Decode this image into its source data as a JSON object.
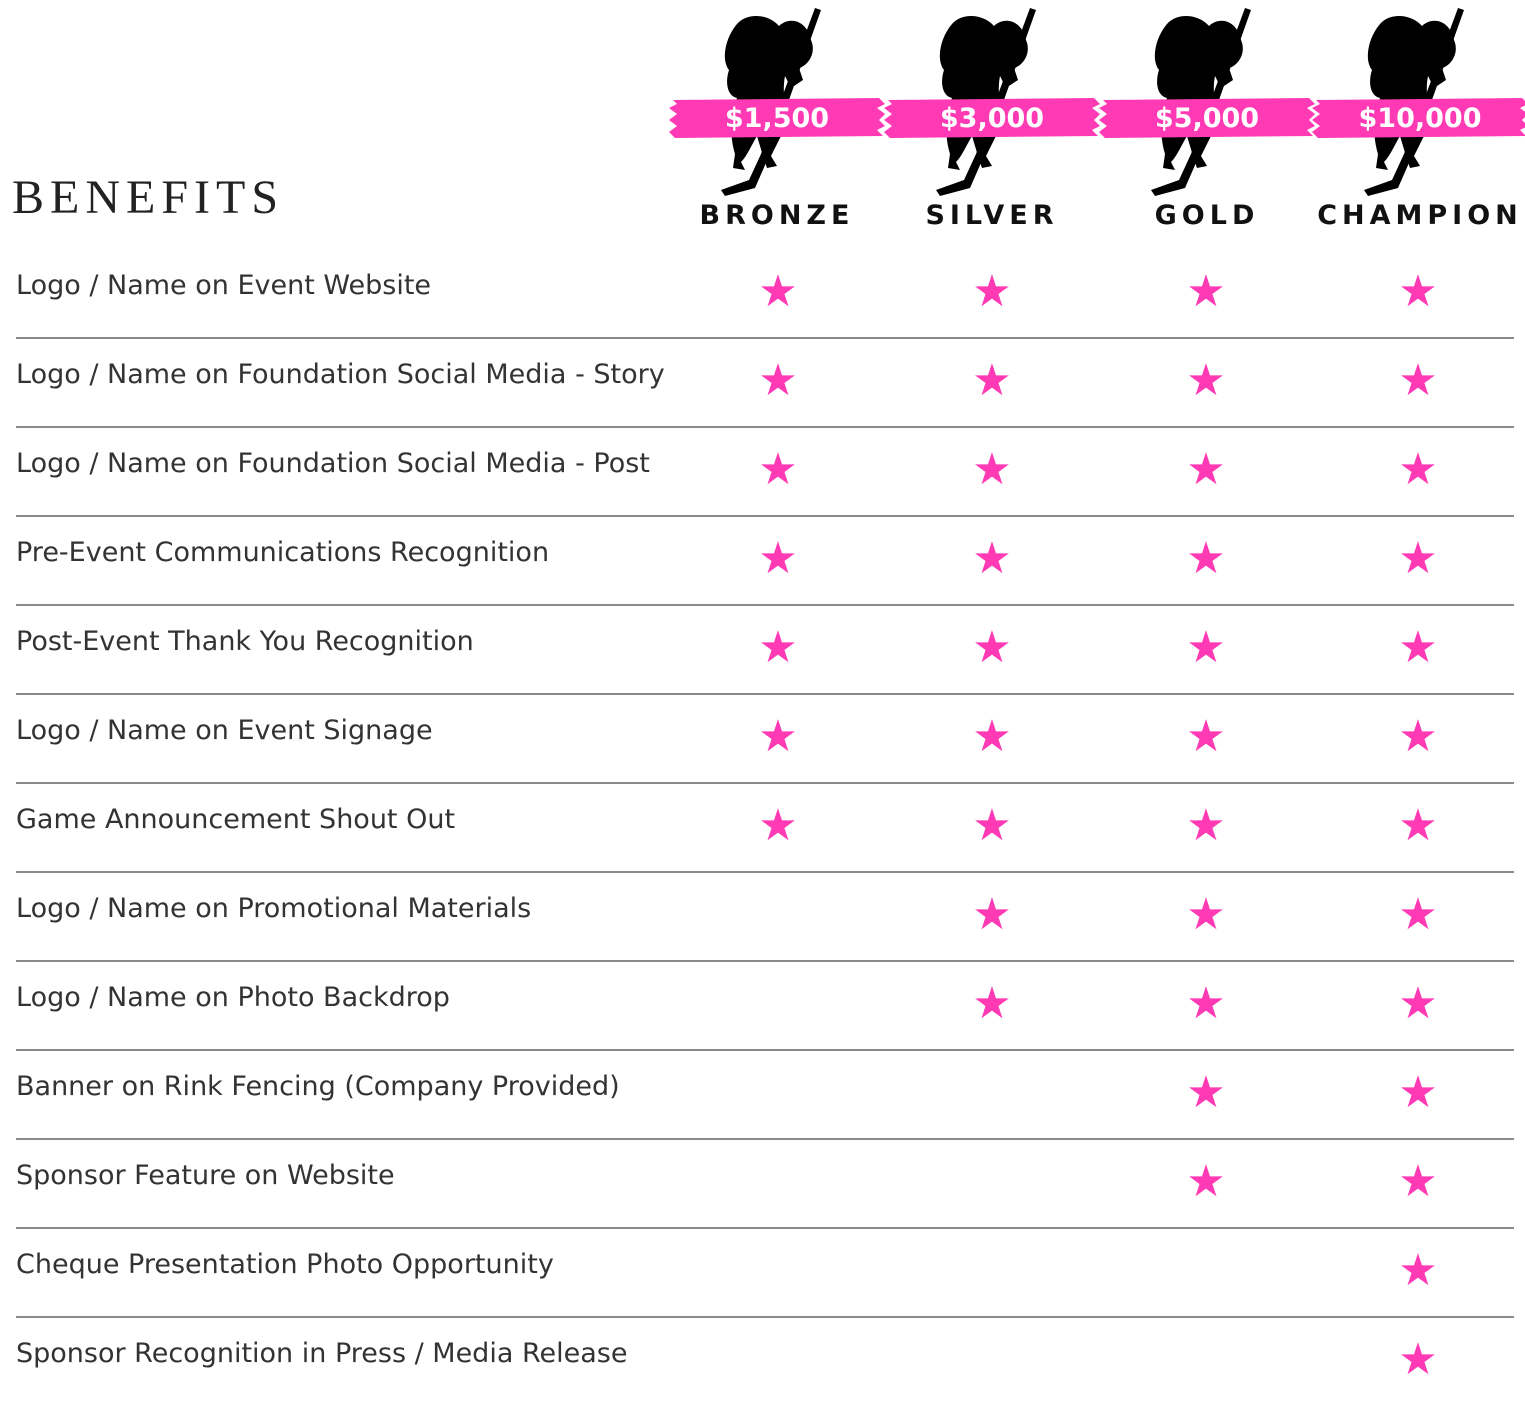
{
  "header": {
    "title": "BENEFITS"
  },
  "tiers": [
    {
      "name": "BRONZE",
      "price": "$1,500"
    },
    {
      "name": "SILVER",
      "price": "$3,000"
    },
    {
      "name": "GOLD",
      "price": "$5,000"
    },
    {
      "name": "CHAMPION",
      "price": "$10,000"
    }
  ],
  "benefits": [
    {
      "label": "Logo / Name on Event Website",
      "tiers": [
        true,
        true,
        true,
        true
      ]
    },
    {
      "label": "Logo / Name on Foundation Social Media - Story",
      "tiers": [
        true,
        true,
        true,
        true
      ]
    },
    {
      "label": "Logo / Name on Foundation Social Media - Post",
      "tiers": [
        true,
        true,
        true,
        true
      ]
    },
    {
      "label": "Pre-Event Communications Recognition",
      "tiers": [
        true,
        true,
        true,
        true
      ]
    },
    {
      "label": "Post-Event Thank You Recognition",
      "tiers": [
        true,
        true,
        true,
        true
      ]
    },
    {
      "label": "Logo / Name on Event Signage",
      "tiers": [
        true,
        true,
        true,
        true
      ]
    },
    {
      "label": "Game Announcement Shout Out",
      "tiers": [
        true,
        true,
        true,
        true
      ]
    },
    {
      "label": "Logo / Name on Promotional Materials",
      "tiers": [
        false,
        true,
        true,
        true
      ]
    },
    {
      "label": "Logo / Name on Photo Backdrop",
      "tiers": [
        false,
        true,
        true,
        true
      ]
    },
    {
      "label": "Banner on Rink Fencing (Company Provided)",
      "tiers": [
        false,
        false,
        true,
        true
      ]
    },
    {
      "label": "Sponsor Feature on Website",
      "tiers": [
        false,
        false,
        true,
        true
      ]
    },
    {
      "label": "Cheque Presentation Photo Opportunity",
      "tiers": [
        false,
        false,
        false,
        true
      ]
    },
    {
      "label": "Sponsor Recognition in Press / Media Release",
      "tiers": [
        false,
        false,
        false,
        true
      ]
    }
  ],
  "colors": {
    "accent": "#ff3ab4",
    "text": "#333333",
    "divider": "#8a8a8a"
  },
  "icons": {
    "player": "hockey-player-icon",
    "star": "star-icon"
  }
}
